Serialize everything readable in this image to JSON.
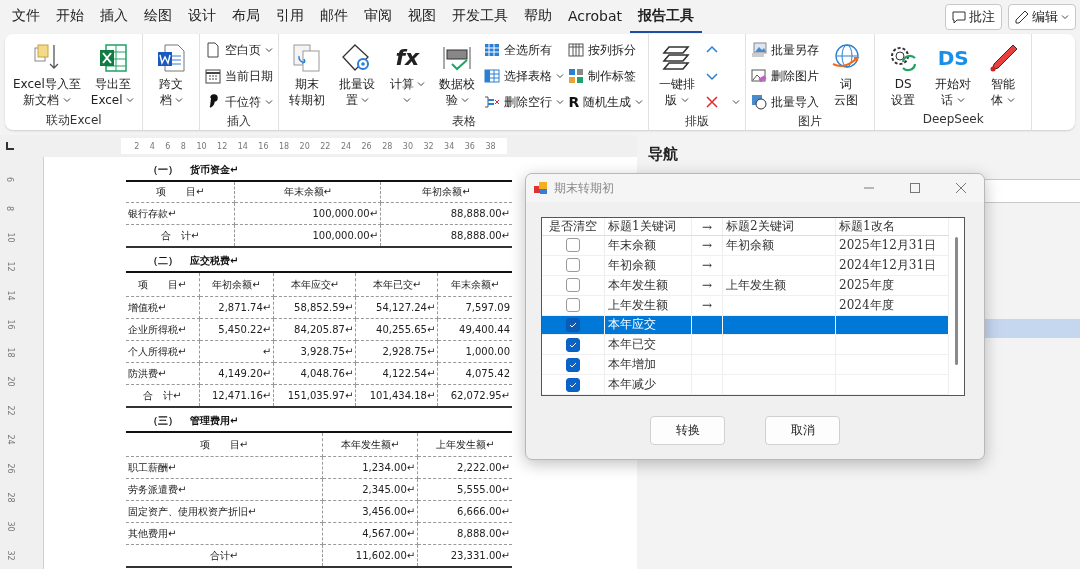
{
  "menu": [
    {
      "label": "文件",
      "selected": false
    },
    {
      "label": "开始",
      "selected": false
    },
    {
      "label": "插入",
      "selected": false
    },
    {
      "label": "绘图",
      "selected": false
    },
    {
      "label": "设计",
      "selected": false
    },
    {
      "label": "布局",
      "selected": false
    },
    {
      "label": "引用",
      "selected": false
    },
    {
      "label": "邮件",
      "selected": false
    },
    {
      "label": "审阅",
      "selected": false
    },
    {
      "label": "视图",
      "selected": false
    },
    {
      "label": "开发工具",
      "selected": false
    },
    {
      "label": "帮助",
      "selected": false
    },
    {
      "label": "Acrobat",
      "selected": false
    },
    {
      "label": "报告工具",
      "selected": true
    }
  ],
  "top_buttons": [
    {
      "label": "批注",
      "kind": "comment",
      "dropdown": false
    },
    {
      "label": "编辑",
      "kind": "edit",
      "dropdown": true
    }
  ],
  "ribbon": {
    "groups": [
      {
        "label": "联动Excel",
        "controls": [
          {
            "kind": "large",
            "lines": [
              "Excel导入至",
              "新文档"
            ],
            "dropdown": true
          },
          {
            "kind": "large",
            "lines": [
              "导出至",
              "Excel"
            ],
            "dropdown": true
          }
        ]
      },
      {
        "controls": [
          {
            "kind": "large",
            "lines": [
              "跨文",
              "档"
            ],
            "dropdown": true
          }
        ]
      },
      {
        "label": "插入",
        "controls": [
          {
            "kind": "stack",
            "items": [
              {
                "label": "空白页",
                "dropdown": true
              },
              {
                "label": "当前日期",
                "dropdown": false
              },
              {
                "label": "千位符",
                "dropdown": true
              }
            ]
          }
        ]
      },
      {
        "label": "表格",
        "controls": [
          {
            "kind": "large",
            "lines": [
              "期末",
              "转期初"
            ],
            "dropdown": false
          },
          {
            "kind": "large",
            "lines": [
              "批量设",
              "置"
            ],
            "dropdown": true
          },
          {
            "kind": "large",
            "glyph": "fx",
            "lines": [
              "计算"
            ],
            "dropdown": true
          },
          {
            "kind": "large",
            "lines": [
              "数据校",
              "验"
            ],
            "dropdown": true
          },
          {
            "kind": "stack",
            "items": [
              {
                "label": "全选所有",
                "dropdown": false
              },
              {
                "label": "选择表格",
                "dropdown": true
              },
              {
                "label": "删除空行",
                "dropdown": true
              }
            ]
          },
          {
            "kind": "stack",
            "items": [
              {
                "label": "按列拆分",
                "dropdown": false
              },
              {
                "label": "制作标签",
                "dropdown": false
              },
              {
                "label": "随机生成",
                "glyph": "R",
                "dropdown": true
              }
            ]
          }
        ]
      },
      {
        "label": "排版",
        "controls": [
          {
            "kind": "large",
            "lines": [
              "一键排",
              "版"
            ],
            "dropdown": true
          },
          {
            "kind": "icons",
            "items": [
              {
                "dropdown": false
              },
              {
                "dropdown": false
              },
              {
                "dropdown": true
              }
            ]
          }
        ]
      },
      {
        "label": "图片",
        "controls": [
          {
            "kind": "stack",
            "items": [
              {
                "label": "批量另存",
                "dropdown": false
              },
              {
                "label": "删除图片",
                "dropdown": false
              },
              {
                "label": "批量导入",
                "dropdown": false
              }
            ]
          },
          {
            "kind": "large",
            "lines": [
              "词",
              "云图"
            ],
            "dropdown": false
          }
        ]
      },
      {
        "label": "DeepSeek",
        "controls": [
          {
            "kind": "large",
            "lines": [
              "DS",
              "设置"
            ],
            "dropdown": false
          },
          {
            "kind": "large",
            "glyph": "DS",
            "lines": [
              "开始对",
              "话"
            ],
            "dropdown": true
          },
          {
            "kind": "large",
            "lines": [
              "智能",
              "体"
            ],
            "dropdown": true
          }
        ]
      }
    ]
  },
  "ruler": {
    "horizontal": [
      "2",
      "4",
      "6",
      "8",
      "10",
      "12",
      "14",
      "16",
      "18",
      "20",
      "22",
      "24",
      "26",
      "28",
      "30",
      "32",
      "34",
      "36",
      "38"
    ],
    "vertical": [
      "6",
      "8",
      "10",
      "12",
      "14",
      "16",
      "18",
      "20",
      "22",
      "24",
      "26",
      "28",
      "30",
      "32"
    ]
  },
  "document": {
    "sections": [
      {
        "number": "（一）",
        "title": "货币资金↵",
        "columns": [
          "项　　目↵",
          "年末余额↵",
          "年初余额↵"
        ],
        "rows": [
          [
            "银行存款↵",
            "100,000.00↵",
            "88,888.00↵"
          ],
          [
            "合　计↵",
            "100,000.00↵",
            "88,888.00↵"
          ]
        ]
      },
      {
        "number": "（二）",
        "title": "应交税费↵",
        "columns": [
          "项　　目↵",
          "年初余额↵",
          "本年应交↵",
          "本年已交↵",
          "年末余额↵"
        ],
        "rows": [
          [
            "增值税↵",
            "2,871.74↵",
            "58,852.59↵",
            "54,127.24↵",
            "7,597.09"
          ],
          [
            "企业所得税↵",
            "5,450.22↵",
            "84,205.87↵",
            "40,255.65↵",
            "49,400.44"
          ],
          [
            "个人所得税↵",
            "↵",
            "3,928.75↵",
            "2,928.75↵",
            "1,000.00"
          ],
          [
            "防洪费↵",
            "4,149.20↵",
            "4,048.76↵",
            "4,122.54↵",
            "4,075.42"
          ],
          [
            "合　计↵",
            "12,471.16↵",
            "151,035.97↵",
            "101,434.18↵",
            "62,072.95↵"
          ]
        ]
      },
      {
        "number": "（三）",
        "title": "管理费用↵",
        "columns": [
          "项　　目↵",
          "本年发生额↵",
          "上年发生额↵"
        ],
        "rows": [
          [
            "职工薪酬↵",
            "1,234.00↵",
            "2,222.00↵"
          ],
          [
            "劳务派遣费↵",
            "2,345.00↵",
            "5,555.00↵"
          ],
          [
            "固定资产、使用权资产折旧↵",
            "3,456.00↵",
            "6,666.00↵"
          ],
          [
            "其他费用↵",
            "4,567.00↵",
            "8,888.00↵"
          ],
          [
            "合计↵",
            "11,602.00↵",
            "23,331.00↵"
          ]
        ]
      }
    ]
  },
  "navigation": {
    "title": "导航"
  },
  "dialog": {
    "title": "期末转期初",
    "columns": [
      "是否清空",
      "标题1关键词",
      "→",
      "标题2关键词",
      "标题1改名"
    ],
    "rows": [
      {
        "clear": false,
        "keyword1": "年末余额",
        "arrow": "→",
        "keyword2": "年初余额",
        "rename": "2025年12月31日",
        "selected": false
      },
      {
        "clear": false,
        "keyword1": "年初余额",
        "arrow": "→",
        "keyword2": "",
        "rename": "2024年12月31日",
        "selected": false
      },
      {
        "clear": false,
        "keyword1": "本年发生额",
        "arrow": "→",
        "keyword2": "上年发生额",
        "rename": "2025年度",
        "selected": false
      },
      {
        "clear": false,
        "keyword1": "上年发生额",
        "arrow": "→",
        "keyword2": "",
        "rename": "2024年度",
        "selected": false
      },
      {
        "clear": true,
        "keyword1": "本年应交",
        "arrow": "",
        "keyword2": "",
        "rename": "",
        "selected": true
      },
      {
        "clear": true,
        "keyword1": "本年已交",
        "arrow": "",
        "keyword2": "",
        "rename": "",
        "selected": false
      },
      {
        "clear": true,
        "keyword1": "本年增加",
        "arrow": "",
        "keyword2": "",
        "rename": "",
        "selected": false
      },
      {
        "clear": true,
        "keyword1": "本年减少",
        "arrow": "",
        "keyword2": "",
        "rename": "",
        "selected": false
      }
    ],
    "buttons": [
      "转换",
      "取消"
    ]
  }
}
